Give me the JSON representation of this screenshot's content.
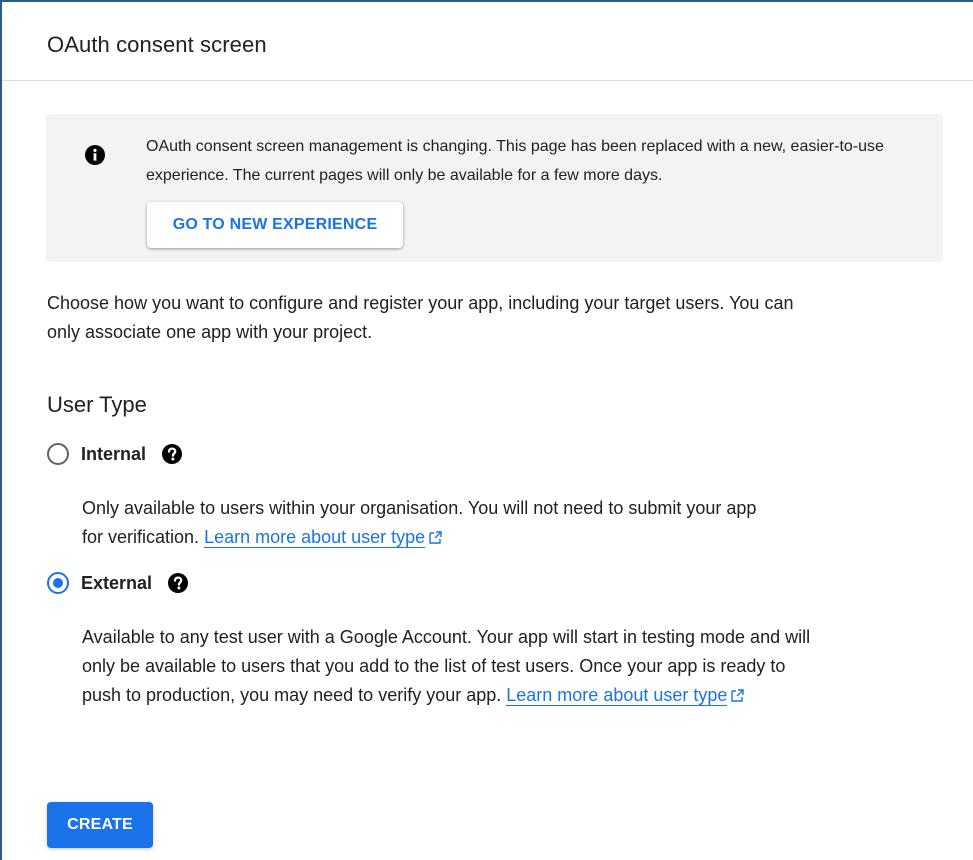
{
  "header": {
    "title": "OAuth consent screen"
  },
  "banner": {
    "icon": "info-icon",
    "text": "OAuth consent screen management is changing. This page has been replaced with a new, easier-to-use experience. The current pages will only be available for a few more days.",
    "button_label": "GO TO NEW EXPERIENCE"
  },
  "intro": "Choose how you want to configure and register your app, including your target users. You can only associate one app with your project.",
  "user_type": {
    "title": "User Type",
    "options": [
      {
        "label": "Internal",
        "checked": false,
        "help_icon": "help-icon",
        "description": "Only available to users within your organisation. You will not need to submit your app for verification.",
        "link": "Learn more about user type"
      },
      {
        "label": "External",
        "checked": true,
        "help_icon": "help-icon",
        "description": "Available to any test user with a Google Account. Your app will start in testing mode and will only be available to users that you add to the list of test users. Once your app is ready to push to production, you may need to verify your app.",
        "link": "Learn more about user type"
      }
    ]
  },
  "actions": {
    "create_label": "CREATE"
  },
  "colors": {
    "accent": "#1a73e8",
    "banner_bg": "#f1f3f4",
    "text": "#202124"
  }
}
